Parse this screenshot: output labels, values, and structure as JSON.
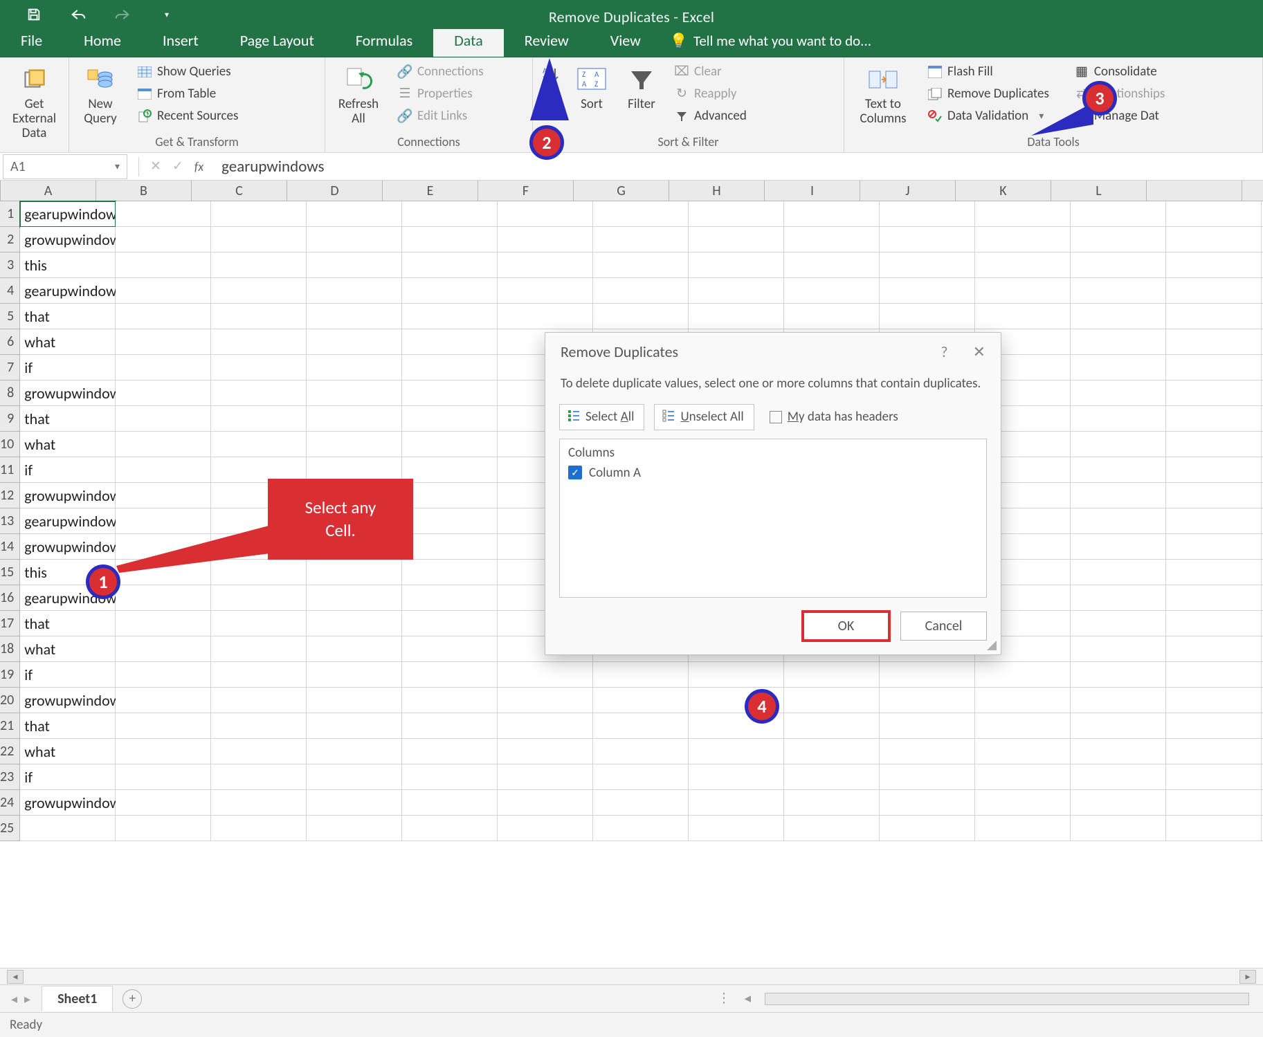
{
  "titlebar": {
    "title": "Remove Duplicates - Excel"
  },
  "tabs": {
    "file": "File",
    "home": "Home",
    "insert": "Insert",
    "page_layout": "Page Layout",
    "formulas": "Formulas",
    "data": "Data",
    "review": "Review",
    "view": "View",
    "tell_me": "Tell me what you want to do..."
  },
  "ribbon": {
    "get_external_data": {
      "label": "Get External\nData",
      "group": ""
    },
    "get_transform": {
      "new_query": "New\nQuery",
      "show_queries": "Show Queries",
      "from_table": "From Table",
      "recent_sources": "Recent Sources",
      "group": "Get & Transform"
    },
    "connections": {
      "refresh_all": "Refresh\nAll",
      "connections": "Connections",
      "properties": "Properties",
      "edit_links": "Edit Links",
      "group": "Connections"
    },
    "sort_filter": {
      "sort": "Sort",
      "filter": "Filter",
      "clear": "Clear",
      "reapply": "Reapply",
      "advanced": "Advanced",
      "group": "Sort & Filter"
    },
    "data_tools": {
      "text_to_columns": "Text to\nColumns",
      "flash_fill": "Flash Fill",
      "remove_duplicates": "Remove Duplicates",
      "data_validation": "Data Validation",
      "consolidate": "Consolidate",
      "relationships": "Relationships",
      "manage_data": "Manage Dat",
      "group": "Data Tools"
    }
  },
  "namebox": {
    "value": "A1"
  },
  "formula": {
    "value": "gearupwindows"
  },
  "columns": [
    "A",
    "B",
    "C",
    "D",
    "E",
    "F",
    "G",
    "H",
    "I",
    "J",
    "K",
    "L"
  ],
  "rows_count": 25,
  "cell_data": {
    "A": [
      "gearupwindows",
      "growupwindows",
      "this",
      "gearupwindows",
      "that",
      "what",
      "if",
      "growupwindows",
      "that",
      "what",
      "if",
      "growupwindows",
      "gearupwindows",
      "growupwindows",
      "this",
      "gearupwindows",
      "that",
      "what",
      "if",
      "growupwindows",
      "that",
      "what",
      "if",
      "growupwindows",
      ""
    ]
  },
  "dialog": {
    "title": "Remove Duplicates",
    "help": "?",
    "close": "✕",
    "message": "To delete duplicate values, select one or more columns that contain duplicates.",
    "select_all": "Select All",
    "unselect_all": "Unselect All",
    "my_data_has_headers": "My data has headers",
    "columns_header": "Columns",
    "column_a": "Column A",
    "ok": "OK",
    "cancel": "Cancel"
  },
  "annotations": {
    "select_any_cell": "Select any Cell.",
    "n1": "1",
    "n2": "2",
    "n3": "3",
    "n4": "4"
  },
  "sheet_tabs": {
    "sheet1": "Sheet1",
    "plus": "+"
  },
  "statusbar": {
    "ready": "Ready"
  }
}
